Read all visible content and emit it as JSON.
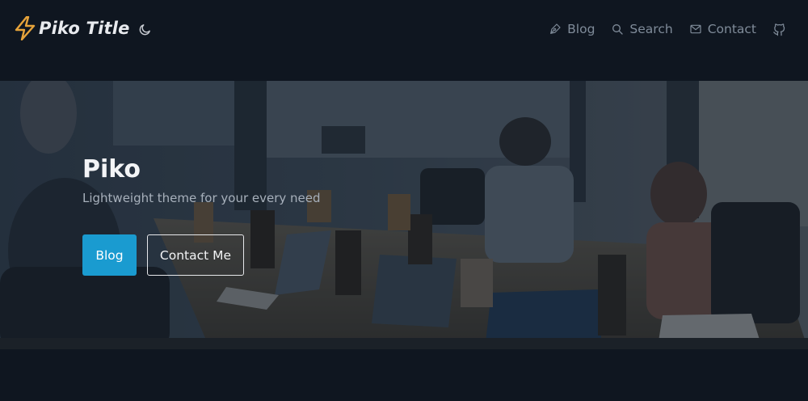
{
  "header": {
    "brand_title": "Piko Title",
    "brand_icon": "lightning-bolt-icon",
    "brand_color": "#e6a33a",
    "theme_toggle_icon": "moon-icon",
    "nav": [
      {
        "label": "Blog",
        "icon": "pen-icon"
      },
      {
        "label": "Search",
        "icon": "search-icon"
      },
      {
        "label": "Contact",
        "icon": "mail-icon"
      }
    ],
    "github_icon": "github-icon"
  },
  "hero": {
    "title": "Piko",
    "subtitle": "Lightweight theme for your every need",
    "primary_button": "Blog",
    "secondary_button": "Contact Me",
    "accent_color": "#1a9bd0"
  },
  "colors": {
    "background": "#0f1620",
    "nav_text": "#7f8b99"
  }
}
